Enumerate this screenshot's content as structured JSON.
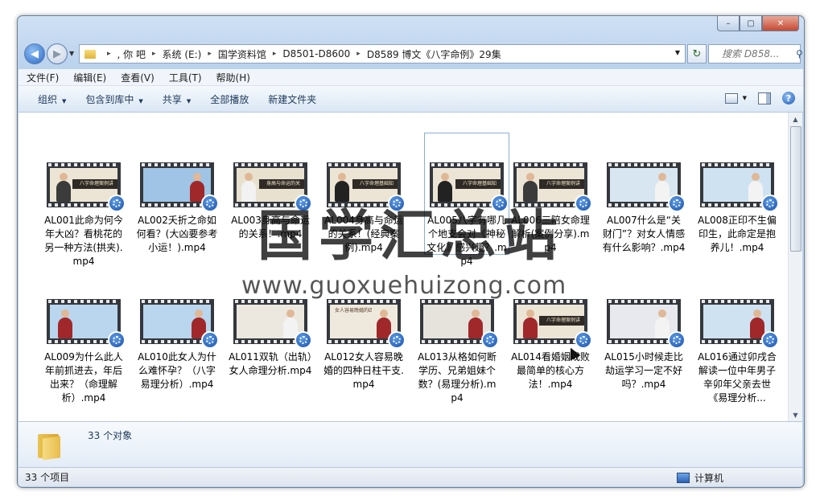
{
  "window": {
    "buttons": [
      "–",
      "▢",
      "✕"
    ]
  },
  "nav": {
    "back": "◀",
    "forward": "▶",
    "recent": "▼",
    "refresh": "↻"
  },
  "address": {
    "crumbs": [
      ", 你    吧",
      "系统 (E:)",
      "国学资料馆",
      "D8501-D8600",
      "D8589 博文《八字命例》29集"
    ],
    "separator": "▸",
    "dropdown": "▼"
  },
  "search": {
    "placeholder": "搜索 D858...",
    "icon": "⚲"
  },
  "menu": [
    "文件(F)",
    "编辑(E)",
    "查看(V)",
    "工具(T)",
    "帮助(H)"
  ],
  "toolbar": {
    "organize": "组织",
    "include_library": "包含到库中",
    "share": "共享",
    "play_all": "全部播放",
    "new_folder": "新建文件夹",
    "help": "?",
    "arrow": "▼"
  },
  "files": [
    {
      "name": "AL001此命为何今年大凶？看桃花的另一种方法(拱夹).mp4",
      "caption": "八字命理案例讲"
    },
    {
      "name": "AL002夭折之命如何看？(大凶要参考小运！).mp4",
      "caption": ""
    },
    {
      "name": "AL003身高与命运的关系！.mp4",
      "caption": "身高与命运的关"
    },
    {
      "name": "AL004身高与命运的关系！(经典案例).mp4",
      "caption": "八字命理基础知"
    },
    {
      "name": "AL005八字有哪几个地支会对《神秘文化》感兴趣？.mp4",
      "caption": "八字命理基础知"
    },
    {
      "name": "AL006三陪女命理解析(案例分享).mp4",
      "caption": "八字命理案例讲"
    },
    {
      "name": "AL007什么是“关财门”？对女人情感有什么影响？.mp4",
      "caption": ""
    },
    {
      "name": "AL008正印不生偏印生，此命定是抱养儿！.mp4",
      "caption": ""
    },
    {
      "name": "AL009为什么此人年前抓进去，年后出来？（命理解析）.mp4",
      "caption": ""
    },
    {
      "name": "AL010此女人为什么难怀孕？（八字易理分析）.mp4",
      "caption": ""
    },
    {
      "name": "AL011双轨（出轨）女人命理分析.mp4",
      "caption": ""
    },
    {
      "name": "AL012女人容易晚婚的四种日柱干支.mp4",
      "caption": "女人容易晚婚的四种日柱干支"
    },
    {
      "name": "AL013从格如何断学历、兄弟姐妹个数？(易理分析).mp4",
      "caption": ""
    },
    {
      "name": "AL014看婚姻成败最简单的核心方法！.mp4",
      "caption": "八字命理案例讲"
    },
    {
      "name": "AL015小时候走比劫运学习一定不好吗？.mp4",
      "caption": ""
    },
    {
      "name": "AL016通过卯戌合解读一位中年男子辛卯年父亲去世《易理分析...",
      "caption": ""
    }
  ],
  "details": {
    "count": "33 个对象"
  },
  "status": {
    "items": "33 个项目",
    "location": "计算机"
  },
  "watermark": {
    "title": "国学汇总站",
    "url": "www.guoxuehuizong.com"
  }
}
